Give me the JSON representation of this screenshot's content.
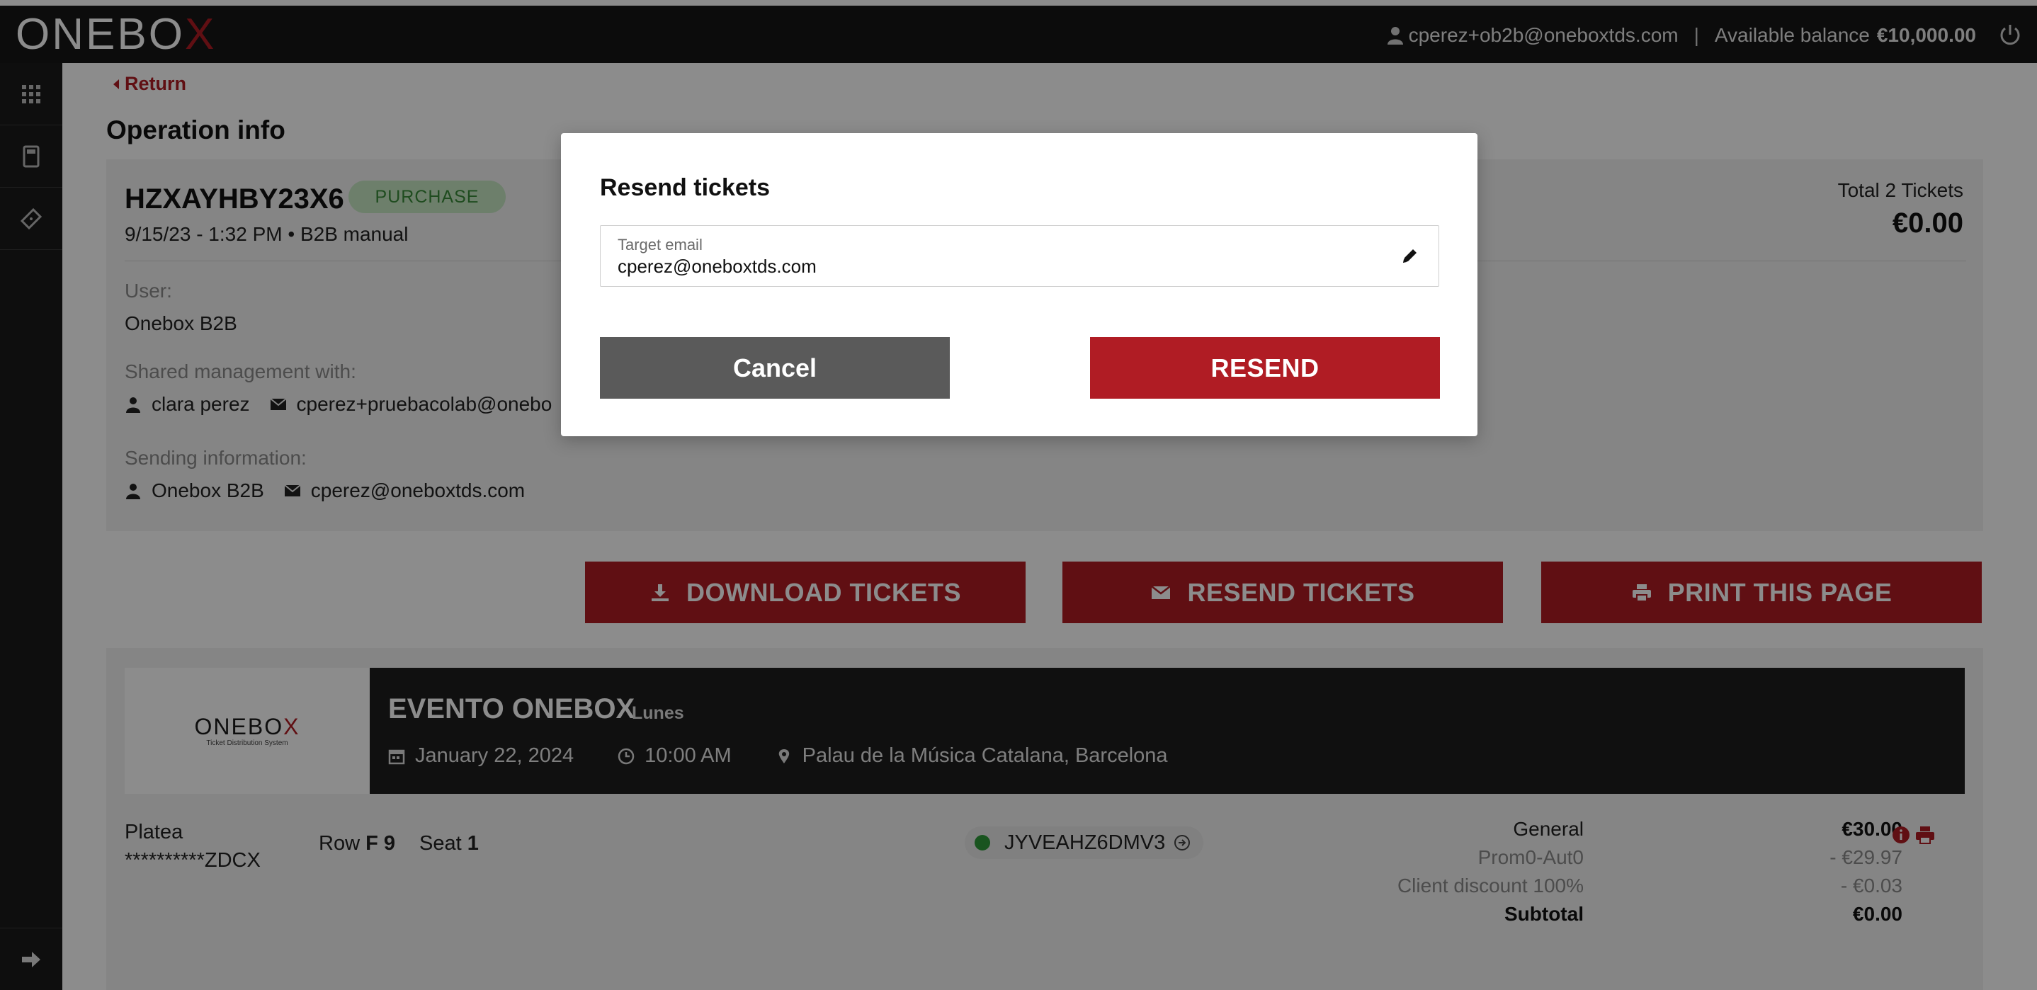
{
  "header": {
    "logo_prefix": "ONEBO",
    "logo_x": "X",
    "user_email": "cperez+ob2b@oneboxtds.com",
    "separator": "|",
    "balance_label": "Available balance",
    "balance_amount": "€10,000.00"
  },
  "sidebar": {
    "items": [
      {
        "icon": "grid-icon"
      },
      {
        "icon": "calculator-icon"
      },
      {
        "icon": "ticket-icon"
      }
    ],
    "bottom_icon": "arrow-right-icon"
  },
  "main": {
    "return_label": "Return",
    "page_title": "Operation info",
    "operation": {
      "code": "HZXAYHBY23X6",
      "type_badge": "PURCHASE",
      "meta": "9/15/23 - 1:32 PM  •  B2B manual",
      "total_label": "Total 2 Tickets",
      "total_value": "€0.00"
    },
    "user_label": "User:",
    "user_value": "Onebox B2B",
    "shared_label": "Shared management with:",
    "shared_name": "clara perez",
    "shared_email": "cperez+pruebacolab@onebo",
    "sending_label": "Sending information:",
    "sending_name": "Onebox B2B",
    "sending_email": "cperez@oneboxtds.com",
    "actions": {
      "download": "DOWNLOAD TICKETS",
      "resend": "RESEND TICKETS",
      "print": "PRINT THIS PAGE"
    },
    "event": {
      "logo_prefix": "ONEBO",
      "logo_x": "X",
      "logo_sub": "Ticket Distribution System",
      "title": "EVENTO ONEBOX",
      "day": "Lunes",
      "date": "January 22, 2024",
      "time": "10:00 AM",
      "venue": "Palau de la Música Catalana, Barcelona"
    },
    "ticket": {
      "zone": "Platea",
      "masked": "**********ZDCX",
      "row_label": "Row",
      "row_value": "F 9",
      "seat_label": "Seat",
      "seat_value": "1",
      "code": "JYVEAHZ6DMV3",
      "status_color": "#2e9a3a",
      "prices": [
        {
          "label": "General",
          "value": "€30.00"
        },
        {
          "label": "Prom0-Aut0",
          "value": "- €29.97"
        },
        {
          "label": "Client discount 100%",
          "value": "- €0.03"
        },
        {
          "label": "Subtotal",
          "value": "€0.00"
        }
      ]
    }
  },
  "modal": {
    "title": "Resend tickets",
    "field_label": "Target email",
    "field_value": "cperez@oneboxtds.com",
    "cancel_label": "Cancel",
    "resend_label": "RESEND"
  },
  "colors": {
    "brand_red": "#b01c24",
    "topbar": "#161616",
    "badge_bg": "#c6e8c4",
    "badge_text": "#3a8a3a"
  }
}
